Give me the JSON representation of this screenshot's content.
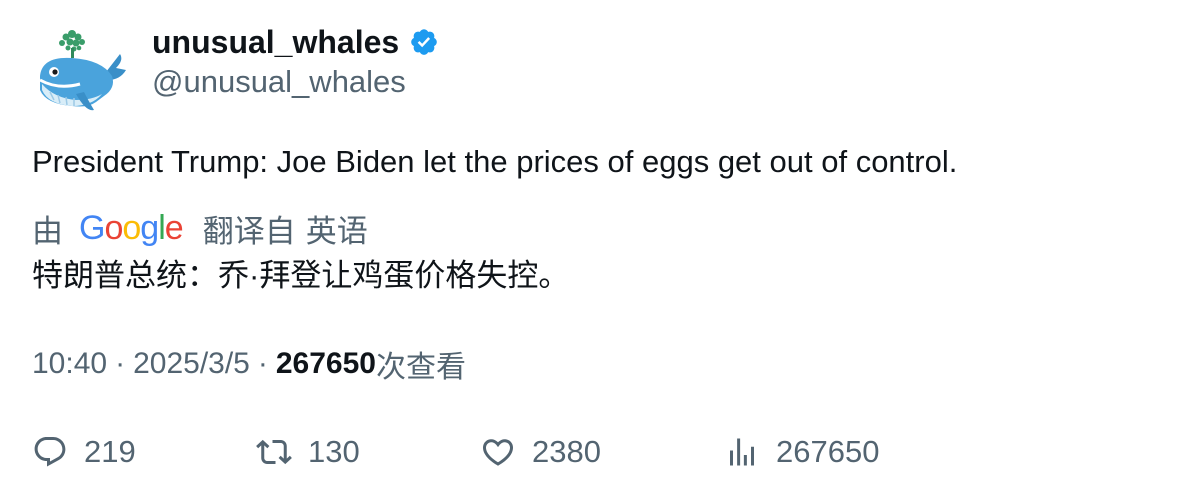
{
  "author": {
    "display_name": "unusual_whales",
    "handle": "@unusual_whales",
    "verified": true,
    "verified_icon": "verified-badge-icon",
    "avatar_icon": "whale-avatar-icon"
  },
  "tweet": {
    "text": "President Trump: Joe Biden let the prices of eggs get out of control."
  },
  "translation": {
    "by_label": "由",
    "provider_logo_letters": [
      "G",
      "o",
      "o",
      "g",
      "l",
      "e"
    ],
    "from_label": "翻译自",
    "language": "英语",
    "text": "特朗普总统：乔·拜登让鸡蛋价格失控。"
  },
  "meta": {
    "time": "10:40",
    "separator": "·",
    "date": "2025/3/5",
    "views_count": "267650",
    "views_label": "次查看"
  },
  "actions": {
    "replies": "219",
    "retweets": "130",
    "likes": "2380",
    "views": "267650"
  },
  "colors": {
    "text_primary": "#0f1419",
    "text_secondary": "#536471",
    "verified_blue": "#1d9bf0"
  }
}
